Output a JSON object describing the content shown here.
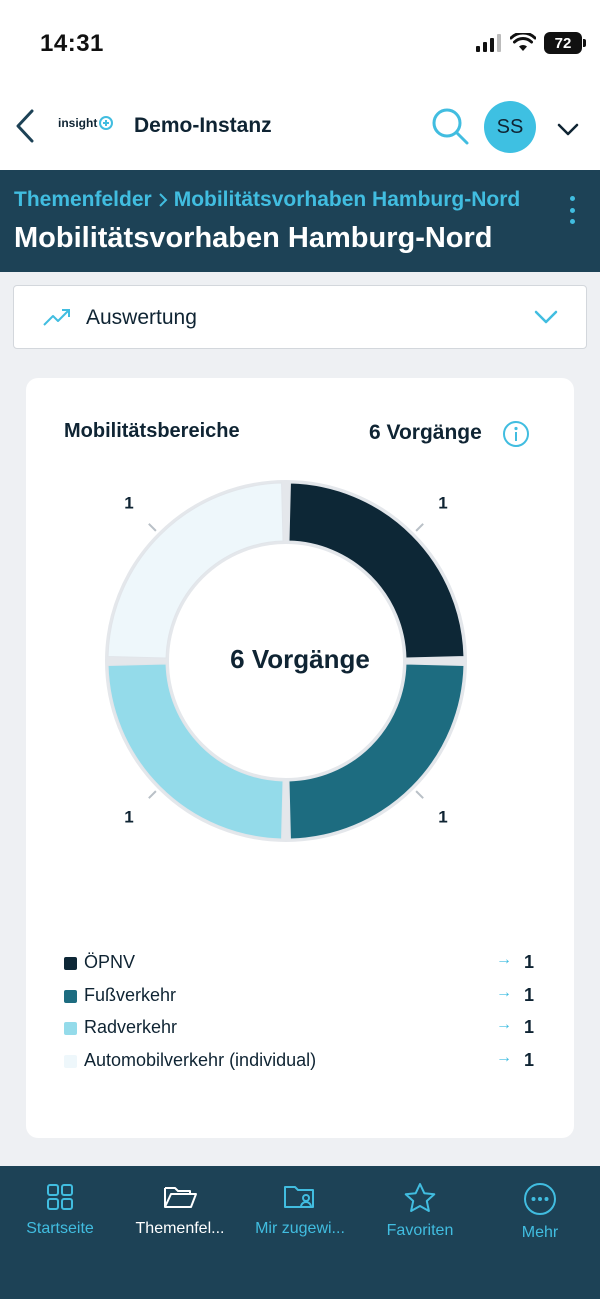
{
  "status_bar": {
    "time": "14:31",
    "battery": "72"
  },
  "app_bar": {
    "brand": "insight",
    "instance": "Demo-Instanz",
    "avatar_initials": "SS"
  },
  "header": {
    "breadcrumb": [
      "Themenfelder",
      "Mobilitätsvorhaben Hamburg-Nord"
    ],
    "title": "Mobilitätsvorhaben Hamburg-Nord"
  },
  "view_selector": {
    "label": "Auswertung"
  },
  "card": {
    "title": "Mobilitätsbereiche",
    "count_label": "6 Vorgänge",
    "center_label": "6 Vorgänge"
  },
  "chart_data": {
    "type": "pie",
    "categories": [
      "ÖPNV",
      "Fußverkehr",
      "Radverkehr",
      "Automobilverkehr (individual)"
    ],
    "values": [
      1,
      1,
      1,
      1
    ],
    "colors": [
      "#0d2736",
      "#1d6c80",
      "#94dbea",
      "#eef7fb"
    ],
    "center_text": "6 Vorgänge",
    "legend_position": "bottom"
  },
  "tabs": [
    {
      "label": "Startseite",
      "icon": "grid-icon",
      "active": false
    },
    {
      "label": "Themenfel...",
      "icon": "folder-open-icon",
      "active": true
    },
    {
      "label": "Mir zugewi...",
      "icon": "folder-user-icon",
      "active": false
    },
    {
      "label": "Favoriten",
      "icon": "star-icon",
      "active": false
    },
    {
      "label": "Mehr",
      "icon": "more-circle-icon",
      "active": false
    }
  ]
}
